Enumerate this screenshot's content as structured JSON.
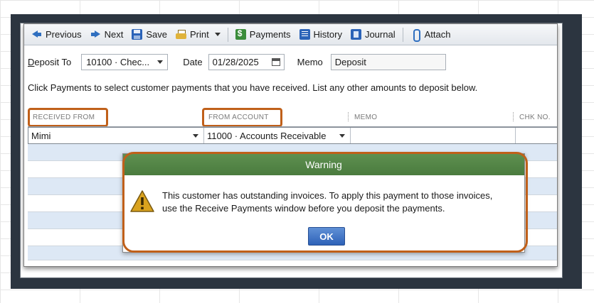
{
  "toolbar": {
    "previous": "Previous",
    "next": "Next",
    "save": "Save",
    "print": "Print",
    "payments": "Payments",
    "history": "History",
    "journal": "Journal",
    "attach": "Attach"
  },
  "form": {
    "deposit_to_label_prefix": "D",
    "deposit_to_label_rest": "eposit To",
    "deposit_to_value": "10100 · Chec...",
    "date_label": "Date",
    "date_value": "01/28/2025",
    "memo_label": "Memo",
    "memo_value": "Deposit",
    "instruction": "Click Payments to select customer payments that you have received. List any other amounts to deposit below."
  },
  "table": {
    "columns": [
      "RECEIVED FROM",
      "FROM ACCOUNT",
      "MEMO",
      "CHK NO."
    ],
    "first_row": {
      "received_from": "Mimi",
      "from_account": "11000 · Accounts Receivable",
      "memo": "",
      "chk_no": ""
    }
  },
  "dialog": {
    "title": "Warning",
    "message_line1": "This customer has outstanding invoices.  To apply this payment to those invoices,",
    "message_line2": "use the Receive Payments window before you deposit the payments.",
    "ok_label": "OK"
  },
  "colors": {
    "highlight": "#c0601a",
    "dialog_title_bar": "#5e9050",
    "ok_button": "#2e62b8",
    "frame": "#2c3540"
  }
}
